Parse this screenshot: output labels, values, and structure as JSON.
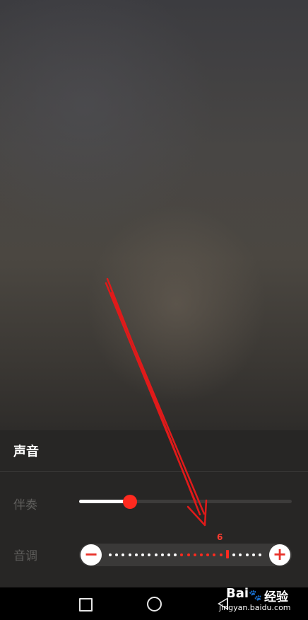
{
  "panel": {
    "title": "声音",
    "accompaniment": {
      "label": "伴奏",
      "level": 0.24
    },
    "pitch": {
      "label": "音调",
      "value": "6",
      "minus_symbol": "−",
      "plus_symbol": "+",
      "steps_total": 24,
      "current_step": 18
    }
  },
  "colors": {
    "accent": "#ff2a1f",
    "panel_bg": "#272625",
    "label_gray": "#5e5d5b"
  },
  "navbar": {
    "icons": [
      "recent-apps-icon",
      "home-icon",
      "back-icon"
    ]
  },
  "watermark": {
    "brand": "Bai",
    "paw": "🐾",
    "cn": "经验",
    "url": "jingyan.baidu.com"
  }
}
